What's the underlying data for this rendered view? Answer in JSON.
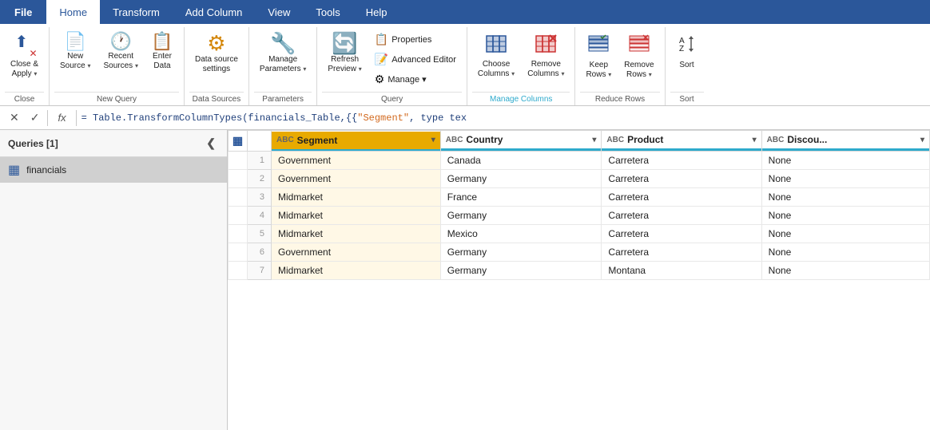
{
  "tabs": {
    "file": "File",
    "home": "Home",
    "transform": "Transform",
    "add_column": "Add Column",
    "view": "View",
    "tools": "Tools",
    "help": "Help"
  },
  "ribbon": {
    "groups": [
      {
        "id": "close",
        "label": "Close",
        "items": [
          {
            "id": "close-apply",
            "icon": "⬆",
            "label": "Close &\nApply",
            "arrow": true
          }
        ]
      },
      {
        "id": "new-query",
        "label": "New Query",
        "items": [
          {
            "id": "new-source",
            "icon": "📄",
            "label": "New\nSource",
            "arrow": true
          },
          {
            "id": "recent-sources",
            "icon": "🕐",
            "label": "Recent\nSources",
            "arrow": true
          },
          {
            "id": "enter-data",
            "icon": "📋",
            "label": "Enter\nData",
            "arrow": false
          }
        ]
      },
      {
        "id": "data-sources",
        "label": "Data Sources",
        "items": [
          {
            "id": "data-source-settings",
            "icon": "⚙",
            "label": "Data source\nsettings",
            "arrow": false
          }
        ]
      },
      {
        "id": "parameters",
        "label": "Parameters",
        "items": [
          {
            "id": "manage-parameters",
            "icon": "🔧",
            "label": "Manage\nParameters",
            "arrow": true
          }
        ]
      },
      {
        "id": "query",
        "label": "Query",
        "items": [
          {
            "id": "refresh-preview",
            "icon": "🔄",
            "label": "Refresh\nPreview",
            "arrow": true
          },
          {
            "id": "properties",
            "icon": "📋",
            "label": "Properties",
            "small": true
          },
          {
            "id": "advanced-editor",
            "icon": "📝",
            "label": "Advanced Editor",
            "small": true
          },
          {
            "id": "manage",
            "icon": "⚙",
            "label": "Manage",
            "small": true,
            "arrow": true
          }
        ]
      },
      {
        "id": "manage-columns",
        "label": "Manage Columns",
        "items": [
          {
            "id": "choose-columns",
            "icon": "▦",
            "label": "Choose\nColumns",
            "arrow": true
          },
          {
            "id": "remove-columns",
            "icon": "✕▦",
            "label": "Remove\nColumns",
            "arrow": true
          }
        ]
      },
      {
        "id": "reduce-rows",
        "label": "Reduce Rows",
        "items": [
          {
            "id": "keep-rows",
            "icon": "▤✓",
            "label": "Keep\nRows",
            "arrow": true
          },
          {
            "id": "remove-rows",
            "icon": "▤✕",
            "label": "Remove\nRows",
            "arrow": true
          }
        ]
      },
      {
        "id": "sort",
        "label": "Sort",
        "items": [
          {
            "id": "sort-az",
            "icon": "↕",
            "label": "Sort",
            "arrow": false
          }
        ]
      }
    ]
  },
  "formula_bar": {
    "cancel_label": "✕",
    "confirm_label": "✓",
    "fx_label": "fx",
    "formula": "= Table.TransformColumnTypes(financials_Table,{{\"Segment\", type tex"
  },
  "sidebar": {
    "header": "Queries [1]",
    "items": [
      {
        "id": "financials",
        "label": "financials",
        "icon": "▦"
      }
    ]
  },
  "grid": {
    "columns": [
      {
        "id": "segment",
        "type": "ABC",
        "label": "Segment",
        "active": true
      },
      {
        "id": "country",
        "type": "ABC",
        "label": "Country",
        "teal": true
      },
      {
        "id": "product",
        "type": "ABC",
        "label": "Product",
        "teal": true
      },
      {
        "id": "discount",
        "type": "ABC",
        "label": "Discou...",
        "teal": true
      }
    ],
    "rows": [
      {
        "num": 1,
        "segment": "Government",
        "country": "Canada",
        "product": "Carretera",
        "discount": "None"
      },
      {
        "num": 2,
        "segment": "Government",
        "country": "Germany",
        "product": "Carretera",
        "discount": "None"
      },
      {
        "num": 3,
        "segment": "Midmarket",
        "country": "France",
        "product": "Carretera",
        "discount": "None"
      },
      {
        "num": 4,
        "segment": "Midmarket",
        "country": "Germany",
        "product": "Carretera",
        "discount": "None"
      },
      {
        "num": 5,
        "segment": "Midmarket",
        "country": "Mexico",
        "product": "Carretera",
        "discount": "None"
      },
      {
        "num": 6,
        "segment": "Government",
        "country": "Germany",
        "product": "Carretera",
        "discount": "None"
      },
      {
        "num": 7,
        "segment": "Midmarket",
        "country": "Germany",
        "product": "Montana",
        "discount": "None"
      }
    ]
  },
  "colors": {
    "active_tab_bg": "#2b579a",
    "active_tab_text": "white",
    "ribbon_bg": "white",
    "active_col_bg": "#e8aa00",
    "teal_border": "#2eaacc",
    "sidebar_selected": "#d0d0d0"
  }
}
